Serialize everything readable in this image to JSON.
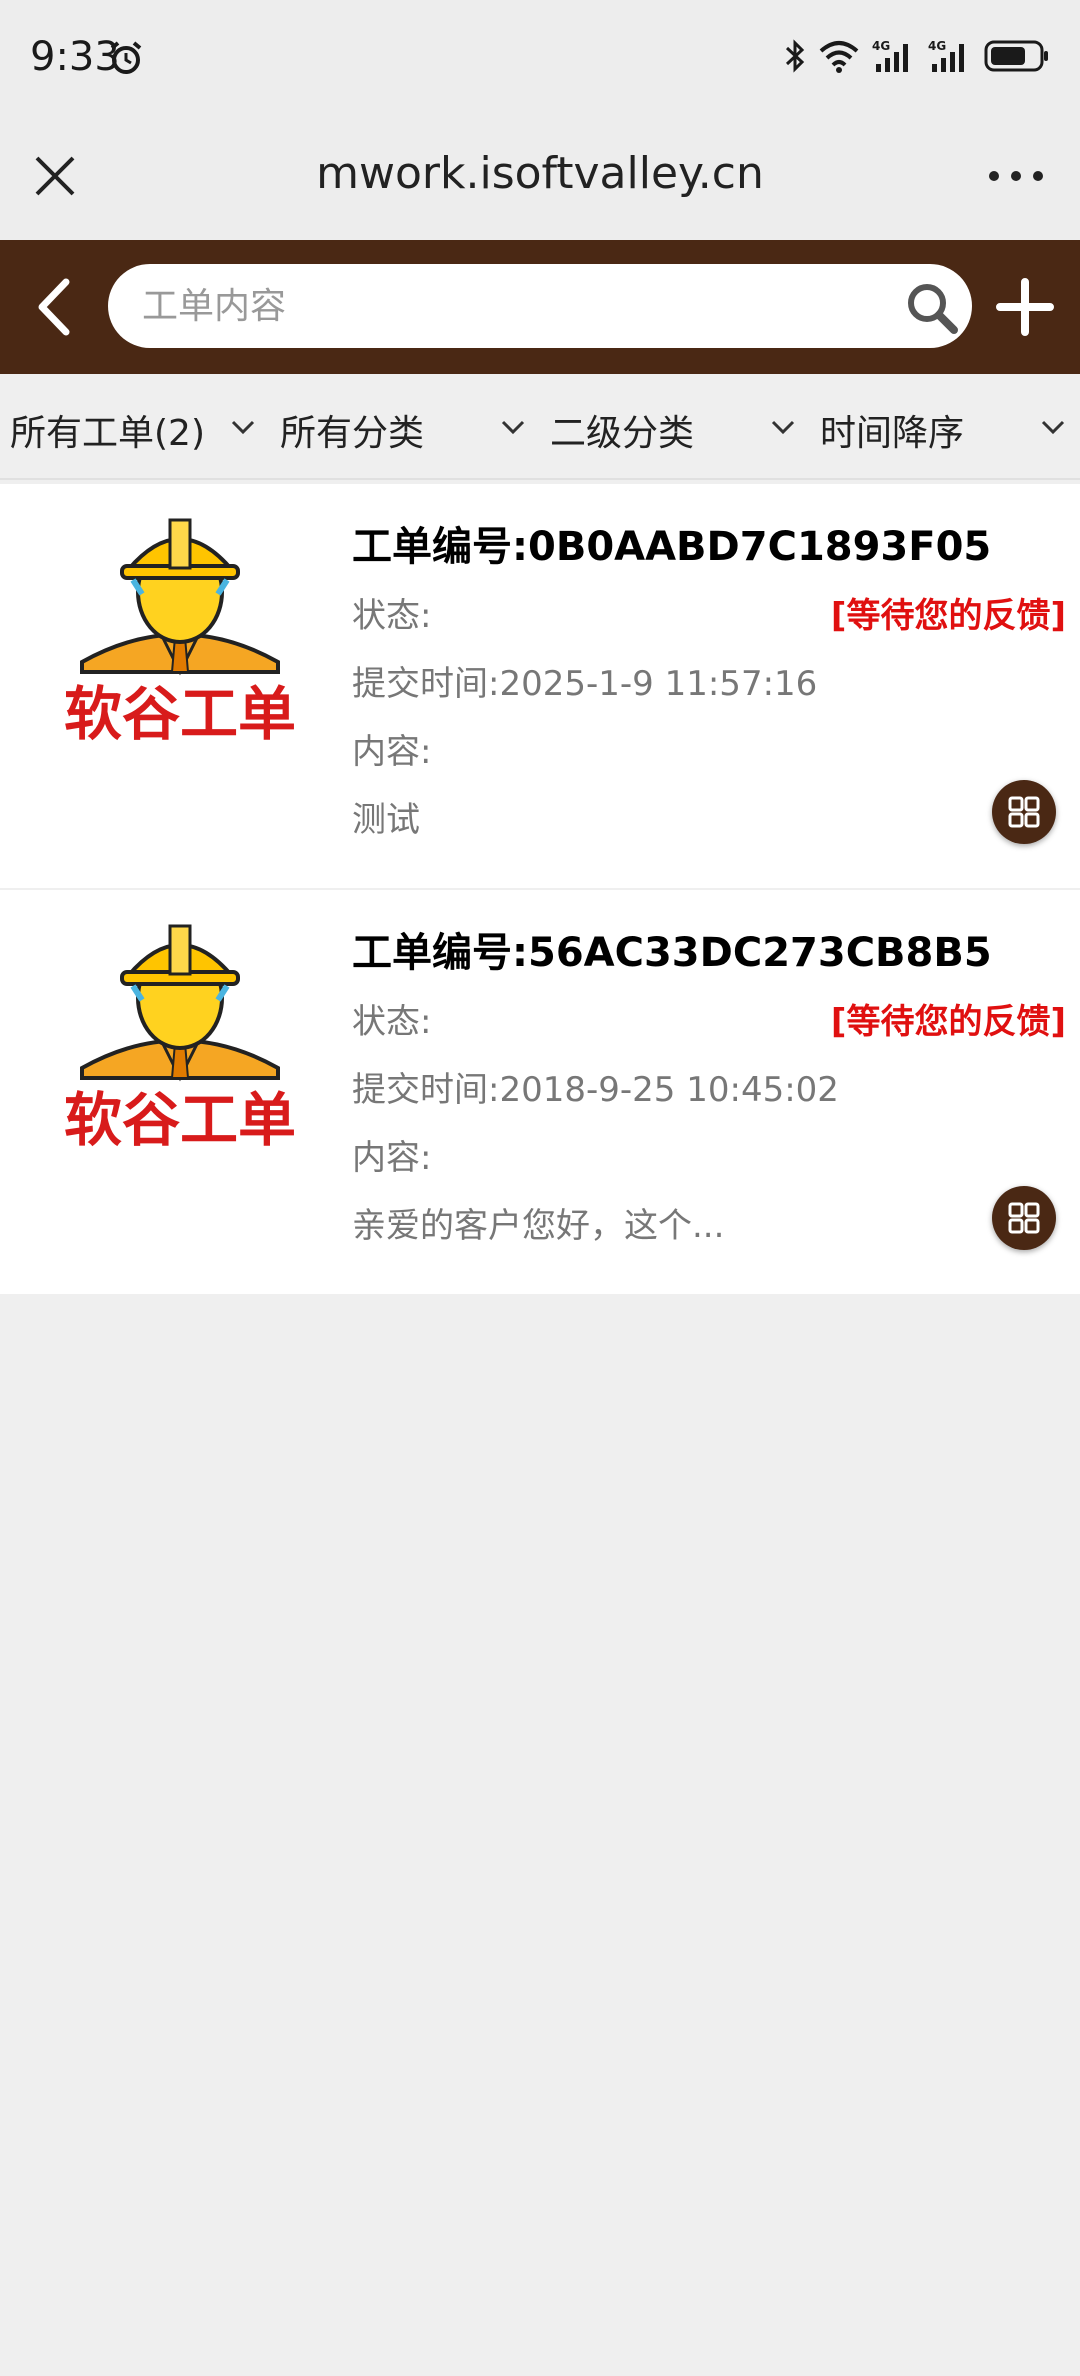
{
  "status_bar": {
    "time": "9:33",
    "network_1": "4G",
    "network_2": "4G"
  },
  "browser": {
    "url_title": "mwork.isoftvalley.cn"
  },
  "search": {
    "placeholder": "工单内容"
  },
  "filters": [
    {
      "label": "所有工单(2)"
    },
    {
      "label": "所有分类"
    },
    {
      "label": "二级分类"
    },
    {
      "label": "时间降序"
    }
  ],
  "colors": {
    "header_bg": "#4a2814",
    "status_red": "#e01010"
  },
  "logo_text": "软谷工单",
  "tickets": [
    {
      "title": "工单编号:0B0AABD7C1893F05",
      "status_label": "状态:",
      "status_value": "[等待您的反馈]",
      "submit_time": "提交时间:2025-1-9 11:57:16",
      "content_label": "内容:",
      "content": "测试"
    },
    {
      "title": "工单编号:56AC33DC273CB8B5",
      "status_label": "状态:",
      "status_value": "[等待您的反馈]",
      "submit_time": "提交时间:2018-9-25 10:45:02",
      "content_label": "内容:",
      "content": "亲爱的客户您好，这个..."
    }
  ]
}
